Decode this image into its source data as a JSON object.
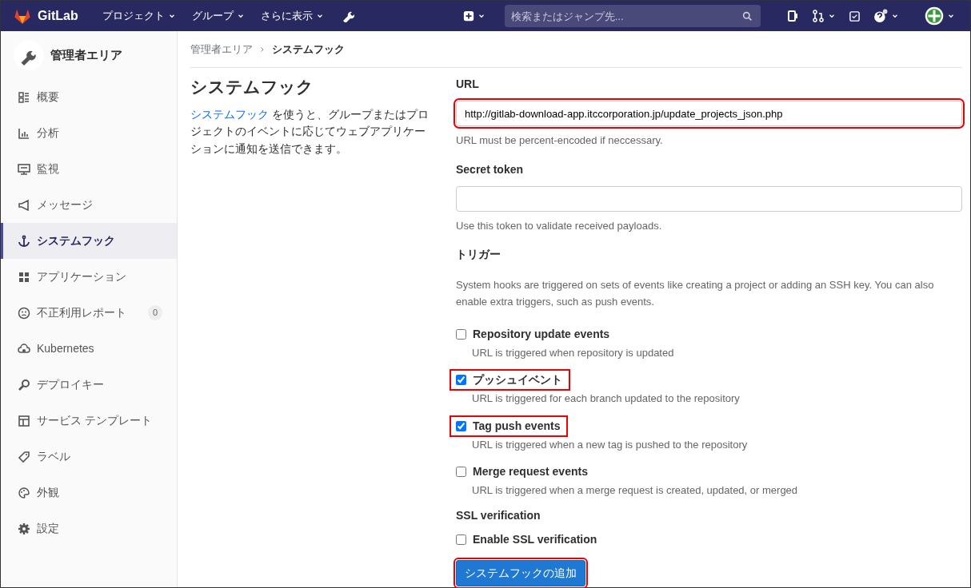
{
  "navbar": {
    "brand": "GitLab",
    "menus": [
      {
        "label": "プロジェクト"
      },
      {
        "label": "グループ"
      },
      {
        "label": "さらに表示"
      }
    ],
    "search": {
      "placeholder": "検索またはジャンプ先..."
    }
  },
  "sidebar": {
    "title": "管理者エリア",
    "items": [
      {
        "label": "概要",
        "selected": false
      },
      {
        "label": "分析",
        "selected": false
      },
      {
        "label": "監視",
        "selected": false
      },
      {
        "label": "メッセージ",
        "selected": false
      },
      {
        "label": "システムフック",
        "selected": true
      },
      {
        "label": "アプリケーション",
        "selected": false
      },
      {
        "label": "不正利用レポート",
        "selected": false,
        "count": "0"
      },
      {
        "label": "Kubernetes",
        "selected": false
      },
      {
        "label": "デプロイキー",
        "selected": false
      },
      {
        "label": "サービス テンプレート",
        "selected": false
      },
      {
        "label": "ラベル",
        "selected": false
      },
      {
        "label": "外観",
        "selected": false
      },
      {
        "label": "設定",
        "selected": false
      }
    ]
  },
  "breadcrumb": [
    {
      "label": "管理者エリア"
    },
    {
      "label": "システムフック"
    }
  ],
  "intro": {
    "title": "システムフック",
    "link": "システムフック",
    "text": " を使うと、グループまたはプロジェクトのイベントに応じてウェブアプリケーションに通知を送信できます。"
  },
  "form": {
    "url": {
      "label": "URL",
      "value": "http://gitlab-download-app.itccorporation.jp/update_projects_json.php",
      "help": "URL must be percent-encoded if neccessary.",
      "highlighted": true
    },
    "token": {
      "label": "Secret token",
      "help": "Use this token to validate received payloads."
    },
    "triggers_title": "トリガー",
    "triggers_text": "System hooks are triggered on sets of events like creating a project or adding an SSH key. You can also enable extra triggers, such as push events.",
    "triggers": [
      {
        "label": "Repository update events",
        "help": "URL is triggered when repository is updated",
        "checked": false,
        "highlighted": false
      },
      {
        "label": "プッシュイベント",
        "help": "URL is triggered for each branch updated to the repository",
        "checked": true,
        "highlighted": true
      },
      {
        "label": "Tag push events",
        "help": "URL is triggered when a new tag is pushed to the repository",
        "checked": true,
        "highlighted": true
      },
      {
        "label": "Merge request events",
        "help": "URL is triggered when a merge request is created, updated, or merged",
        "checked": false,
        "highlighted": false
      }
    ],
    "ssl_title": "SSL verification",
    "ssl": {
      "label": "Enable SSL verification",
      "checked": false
    },
    "submit": {
      "label": "システムフックの追加",
      "highlighted": true
    }
  }
}
